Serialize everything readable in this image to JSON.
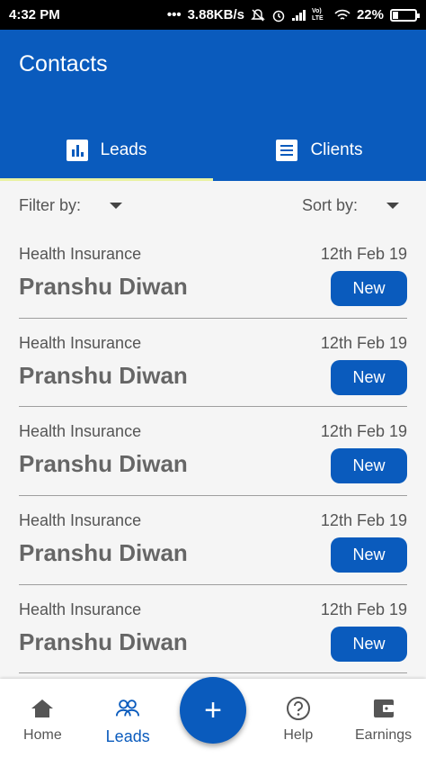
{
  "status_bar": {
    "time": "4:32 PM",
    "dots": "•••",
    "speed": "3.88KB/s",
    "network_label": "Vo) LTE",
    "battery": "22%",
    "battery_level": 0.22,
    "icons": [
      "mute-icon",
      "alarm-icon",
      "signal-icon",
      "wifi-icon",
      "battery-icon"
    ]
  },
  "app_bar": {
    "title": "Contacts"
  },
  "tabs": [
    {
      "label": "Leads",
      "icon": "bar-chart-icon",
      "active": true
    },
    {
      "label": "Clients",
      "icon": "receipt-icon",
      "active": false
    }
  ],
  "filter": {
    "filter_label": "Filter by:",
    "sort_label": "Sort by:"
  },
  "leads": [
    {
      "type": "Health Insurance",
      "date": "12th Feb 19",
      "name": "Pranshu Diwan",
      "status": "New"
    },
    {
      "type": "Health Insurance",
      "date": "12th Feb 19",
      "name": "Pranshu Diwan",
      "status": "New"
    },
    {
      "type": "Health Insurance",
      "date": "12th Feb 19",
      "name": "Pranshu Diwan",
      "status": "New"
    },
    {
      "type": "Health Insurance",
      "date": "12th Feb 19",
      "name": "Pranshu Diwan",
      "status": "New"
    },
    {
      "type": "Health Insurance",
      "date": "12th Feb 19",
      "name": "Pranshu Diwan",
      "status": "New"
    }
  ],
  "bottom_nav": [
    {
      "label": "Home",
      "icon": "home-icon",
      "active": false
    },
    {
      "label": "Leads",
      "icon": "people-icon",
      "active": true
    },
    {
      "label": "",
      "icon": "",
      "active": false
    },
    {
      "label": "Help",
      "icon": "help-icon",
      "active": false
    },
    {
      "label": "Earnings",
      "icon": "wallet-icon",
      "active": false
    }
  ],
  "fab": {
    "symbol": "+",
    "icon": "plus-icon"
  },
  "colors": {
    "primary": "#0a5bbd",
    "tab_indicator": "#e9f2a2",
    "background": "#f5f5f5",
    "text": "#555555"
  }
}
